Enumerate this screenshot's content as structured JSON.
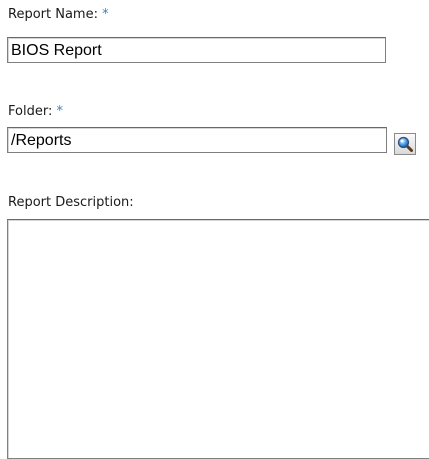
{
  "report_name": {
    "label": "Report Name:",
    "required_marker": "*",
    "value": "BIOS Report"
  },
  "folder": {
    "label": "Folder:",
    "required_marker": "*",
    "value": "/Reports",
    "browse_icon": "magnifier-icon"
  },
  "report_description": {
    "label": "Report Description:",
    "value": ""
  },
  "colors": {
    "required_marker": "#3b7fc4",
    "input_border": "#7f7f7f"
  }
}
